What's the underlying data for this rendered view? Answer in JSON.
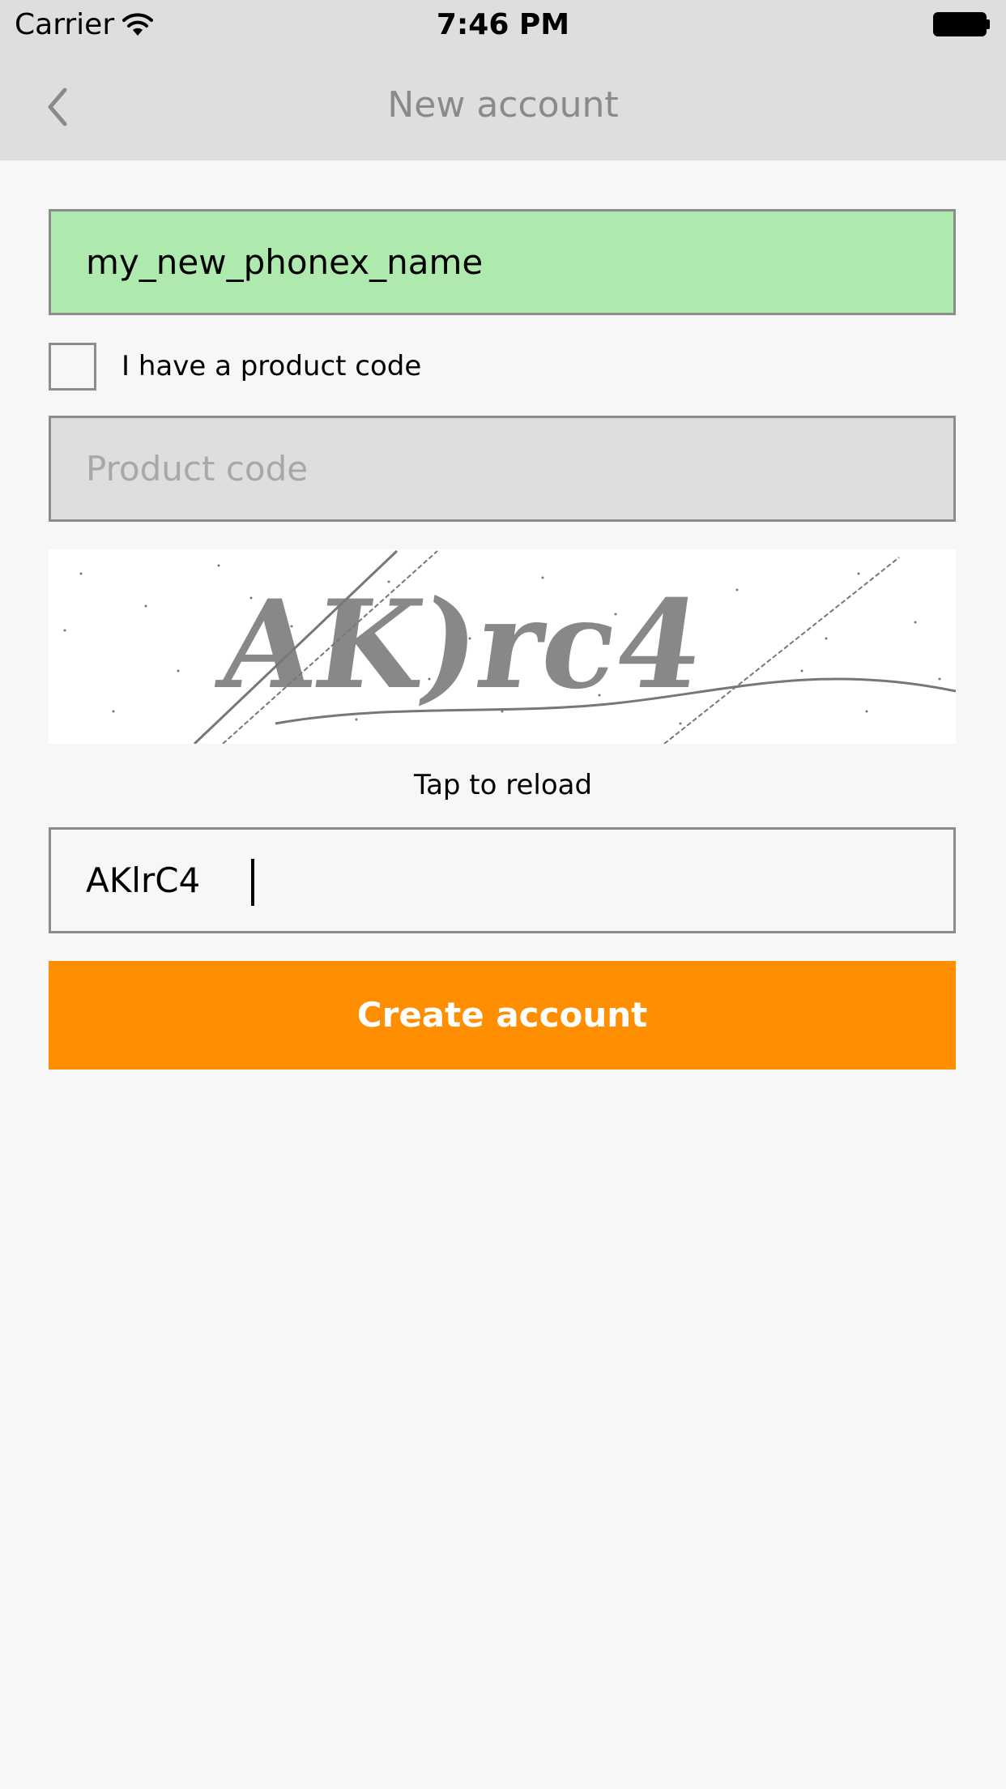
{
  "status_bar": {
    "carrier": "Carrier",
    "time": "7:46 PM",
    "wifi_icon": "wifi-icon",
    "battery_icon": "battery-full-icon"
  },
  "nav": {
    "title": "New account",
    "back_icon": "chevron-left-icon"
  },
  "form": {
    "username_value": "my_new_phonex_name",
    "username_bg": "#aeeaad",
    "product_code_checkbox_label": "I have a product code",
    "product_code_checked": false,
    "product_code_placeholder": "Product code",
    "captcha_image_text": "AK)rc4",
    "reload_label": "Tap to reload",
    "captcha_input_value": "AKlrC4",
    "create_button_label": "Create account"
  },
  "colors": {
    "accent": "#ff8e00",
    "bar_bg": "#dedede",
    "page_bg": "#f7f7f7",
    "valid_field": "#aeeaad"
  }
}
